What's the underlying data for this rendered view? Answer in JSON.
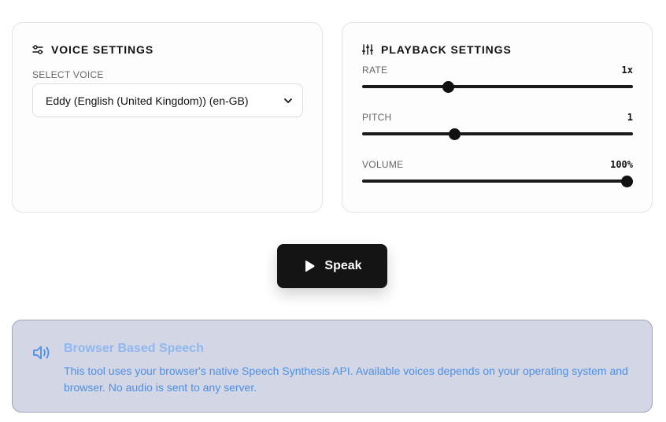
{
  "voice_settings": {
    "title": "VOICE SETTINGS",
    "select_label": "SELECT VOICE",
    "selected_voice": "Eddy (English (United Kingdom)) (en-GB)"
  },
  "playback_settings": {
    "title": "PLAYBACK SETTINGS",
    "rate": {
      "label": "RATE",
      "display": "1x",
      "value": 1,
      "min": 0.1,
      "max": 3
    },
    "pitch": {
      "label": "PITCH",
      "display": "1",
      "value": 1,
      "min": 0,
      "max": 3
    },
    "volume": {
      "label": "VOLUME",
      "display": "100%",
      "value": 1,
      "min": 0,
      "max": 1
    }
  },
  "speak_button": {
    "label": "Speak"
  },
  "info": {
    "title": "Browser Based Speech",
    "text": "This tool uses your browser's native Speech Synthesis API. Available voices depends on your operating system and browser. No audio is sent to any server."
  },
  "colors": {
    "accent_dark": "#141414",
    "info_bg": "#d3d6e4",
    "info_title": "#8fb7f0",
    "info_text": "#4d8fe6"
  },
  "icons": {
    "voice_settings": "sliders-horizontal-icon",
    "playback_settings": "sliders-vertical-icon",
    "speak": "play-icon",
    "info": "speaker-volume-icon",
    "select": "chevron-down-icon"
  }
}
